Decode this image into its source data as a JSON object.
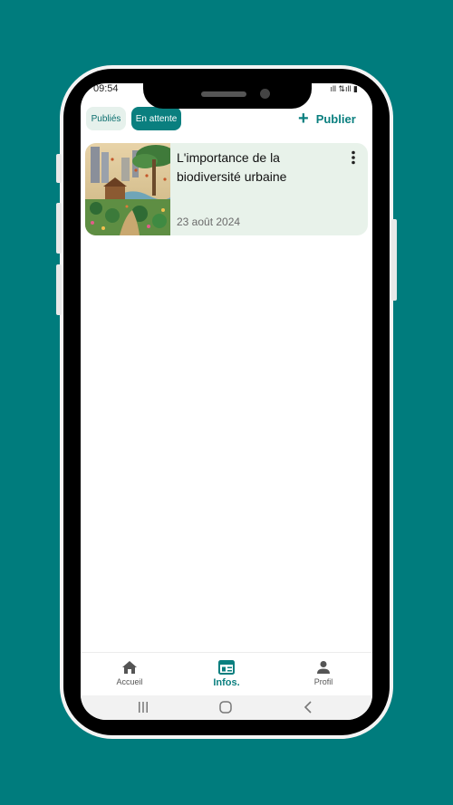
{
  "status_bar": {
    "time": "09:54",
    "right_icons": "ıll ⇅ıll ▮"
  },
  "tabs": {
    "published_label": "Publiés",
    "pending_label": "En attente",
    "active": "pending"
  },
  "publish_button": {
    "label": "Publier",
    "icon": "plus-icon"
  },
  "posts": [
    {
      "title": "L'importance de la biodiversité urbaine",
      "date": "23 août 2024",
      "image": "urban-garden-illustration",
      "menu_icon": "more-vertical-icon"
    }
  ],
  "bottom_nav": {
    "items": [
      {
        "label": "Accueil",
        "icon": "home-icon"
      },
      {
        "label": "Infos.",
        "icon": "news-icon",
        "active": true
      },
      {
        "label": "Profil",
        "icon": "person-icon"
      }
    ]
  },
  "system_nav": [
    "recent-apps-icon",
    "home-circle-icon",
    "back-icon"
  ],
  "colors": {
    "background": "#007c7d",
    "accent": "#0a7f7f",
    "card_bg": "#e8f2ea",
    "tab_inactive_bg": "#e6f1ec"
  }
}
